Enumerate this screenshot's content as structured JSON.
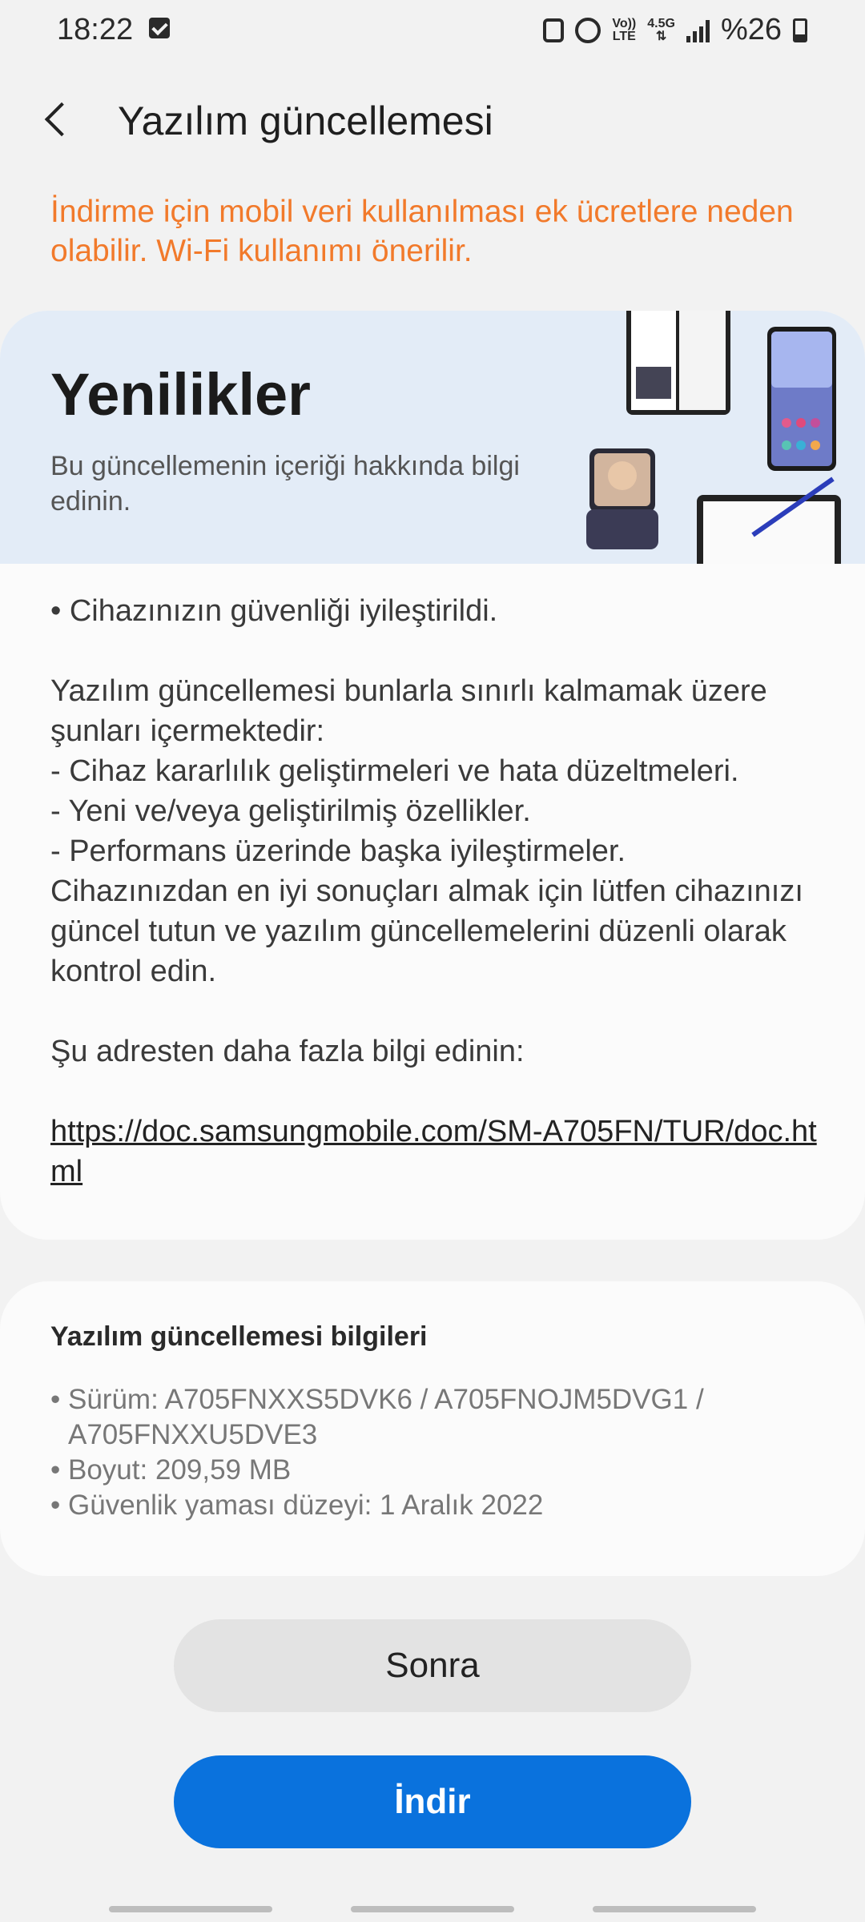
{
  "status_bar": {
    "time": "18:22",
    "volte_top": "Vo))",
    "volte_bottom": "LTE",
    "network": "4.5G",
    "battery": "%26",
    "icons": [
      "check-notification-icon",
      "battery-saver-icon",
      "alarm-icon",
      "volte-icon",
      "network-arrows-icon",
      "signal-icon",
      "battery-icon"
    ]
  },
  "header": {
    "title": "Yazılım güncellemesi"
  },
  "warning": "İndirme için mobil veri kullanılması ek ücretlere neden olabilir. Wi-Fi kullanımı önerilir.",
  "whats_new": {
    "title": "Yenilikler",
    "subtitle": "Bu güncellemenin içeriği hakkında bilgi edinin.",
    "body": "• Cihazınızın güvenliği iyileştirildi.\n\nYazılım güncellemesi bunlarla sınırlı kalmamak üzere şunları içermektedir:\n - Cihaz kararlılık geliştirmeleri ve hata düzeltmeleri.\n - Yeni ve/veya geliştirilmiş özellikler.\n - Performans üzerinde başka iyileştirmeler.\nCihazınızdan en iyi sonuçları almak için lütfen cihazınızı güncel tutun ve yazılım güncellemelerini düzenli olarak kontrol edin.\n\nŞu adresten daha fazla bilgi edinin:",
    "link": "https://doc.samsungmobile.com/SM-A705FN/TUR/doc.html"
  },
  "info": {
    "title": "Yazılım güncellemesi bilgileri",
    "bullet": "•",
    "items": [
      "Sürüm: A705FNXXS5DVK6 / A705FNOJM5DVG1 / A705FNXXU5DVE3",
      "Boyut: 209,59 MB",
      "Güvenlik yaması düzeyi: 1 Aralık 2022"
    ]
  },
  "buttons": {
    "later": "Sonra",
    "download": "İndir"
  },
  "colors": {
    "warning": "#f27a2b",
    "primary": "#0a72dd",
    "banner_bg": "#e3ecf7"
  }
}
